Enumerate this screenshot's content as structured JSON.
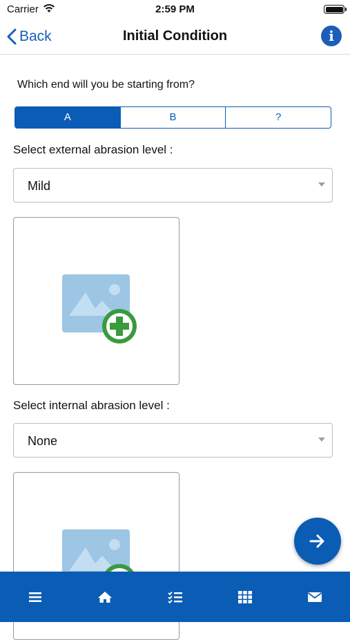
{
  "status_bar": {
    "carrier": "Carrier",
    "time": "2:59 PM"
  },
  "nav": {
    "back_label": "Back",
    "title": "Initial Condition",
    "info_icon": "i"
  },
  "start_end": {
    "question": "Which end will you be starting from?",
    "options": [
      "A",
      "B",
      "?"
    ],
    "selected": "A"
  },
  "external": {
    "label": "Select external abrasion level :",
    "value": "Mild"
  },
  "internal": {
    "label": "Select internal abrasion level :",
    "value": "None"
  },
  "colors": {
    "primary": "#0b5cb5",
    "add_badge": "#3a9a3e",
    "image_placeholder": "#9cc6e4"
  },
  "icons": {
    "back": "chevron-left-icon",
    "info": "info-icon",
    "add_photo": "add-photo-icon",
    "next": "arrow-right-icon",
    "tabs": [
      "menu-icon",
      "home-icon",
      "checklist-icon",
      "grid-icon",
      "mail-icon"
    ]
  }
}
